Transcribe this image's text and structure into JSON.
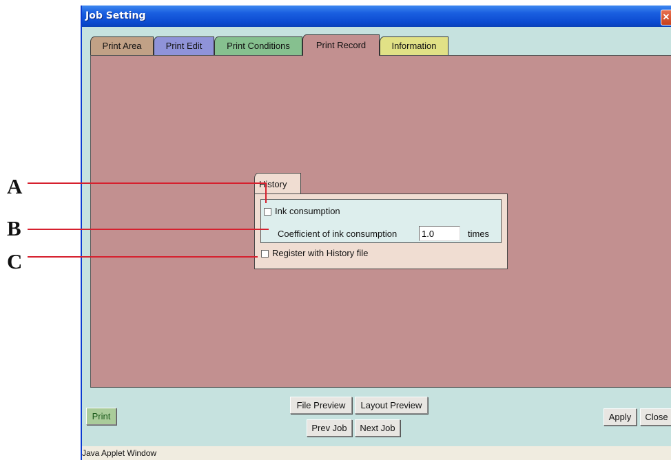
{
  "window": {
    "title": "Job Setting",
    "close_glyph": "✕"
  },
  "tabs": [
    {
      "label": "Print Area"
    },
    {
      "label": "Print Edit"
    },
    {
      "label": "Print Conditions"
    },
    {
      "label": "Print Record",
      "selected": true
    },
    {
      "label": "Information"
    }
  ],
  "history": {
    "tab_label": "History",
    "ink_consumption": {
      "label": "Ink consumption",
      "checked": false
    },
    "coefficient": {
      "label": "Coefficient of ink consumption",
      "value": "1.0",
      "unit": "times"
    },
    "register": {
      "label": "Register with History file",
      "checked": false
    }
  },
  "buttons": {
    "print": "Print",
    "file_preview": "File Preview",
    "layout_preview": "Layout Preview",
    "prev_job": "Prev Job",
    "next_job": "Next Job",
    "apply": "Apply",
    "close": "Close"
  },
  "status": "Java Applet Window",
  "callouts": [
    "A",
    "B",
    "C"
  ],
  "colors": {
    "title_bar": "#0b4ad0",
    "window_bg": "#c6e2df",
    "panel_bg": "#c29090",
    "history_bg": "#f0ddd2",
    "callout_line": "#d6202e"
  }
}
